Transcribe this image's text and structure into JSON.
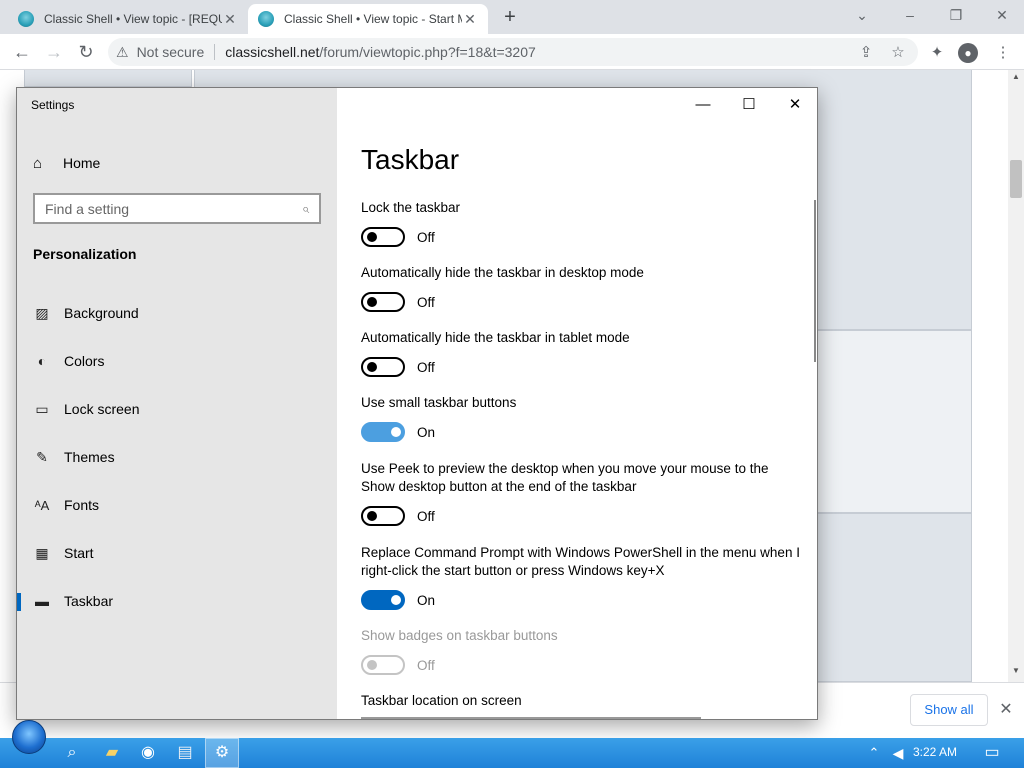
{
  "browser": {
    "tabs": [
      {
        "title": "Classic Shell • View topic - [REQUEST]",
        "active": false
      },
      {
        "title": "Classic Shell • View topic - Start Menu",
        "active": true
      }
    ],
    "not_secure": "Not secure",
    "url_host": "classicshell.net",
    "url_path": "/forum/viewtopic.php?f=18&t=3207",
    "icons": {
      "back": "back-arrow-icon",
      "forward": "forward-arrow-icon",
      "reload": "reload-icon",
      "warning": "warning-icon",
      "share": "share-icon",
      "star": "star-icon",
      "extensions": "puzzle-icon",
      "profile": "profile-icon",
      "menu": "kebab-menu-icon"
    }
  },
  "download_bar": {
    "show_all": "Show all"
  },
  "settings": {
    "window_title": "Settings",
    "home": "Home",
    "search_placeholder": "Find a setting",
    "category": "Personalization",
    "nav_items": [
      "Background",
      "Colors",
      "Lock screen",
      "Themes",
      "Fonts",
      "Start",
      "Taskbar"
    ],
    "selected_nav": "Taskbar",
    "page_title": "Taskbar",
    "options": [
      {
        "label": "Lock the taskbar",
        "state": "Off"
      },
      {
        "label": "Automatically hide the taskbar in desktop mode",
        "state": "Off"
      },
      {
        "label": "Automatically hide the taskbar in tablet mode",
        "state": "Off"
      },
      {
        "label": "Use small taskbar buttons",
        "state": "On"
      },
      {
        "label": "Use Peek to preview the desktop when you move your mouse to the Show desktop button at the end of the taskbar",
        "state": "Off"
      },
      {
        "label": "Replace Command Prompt with Windows PowerShell in the menu when I right-click the start button or press Windows key+X",
        "state": "On"
      },
      {
        "label": "Show badges on taskbar buttons",
        "state": "Off",
        "disabled": true
      }
    ],
    "location_label": "Taskbar location on screen",
    "accent": "#0067c0"
  },
  "taskbar": {
    "time": "3:22 AM"
  }
}
